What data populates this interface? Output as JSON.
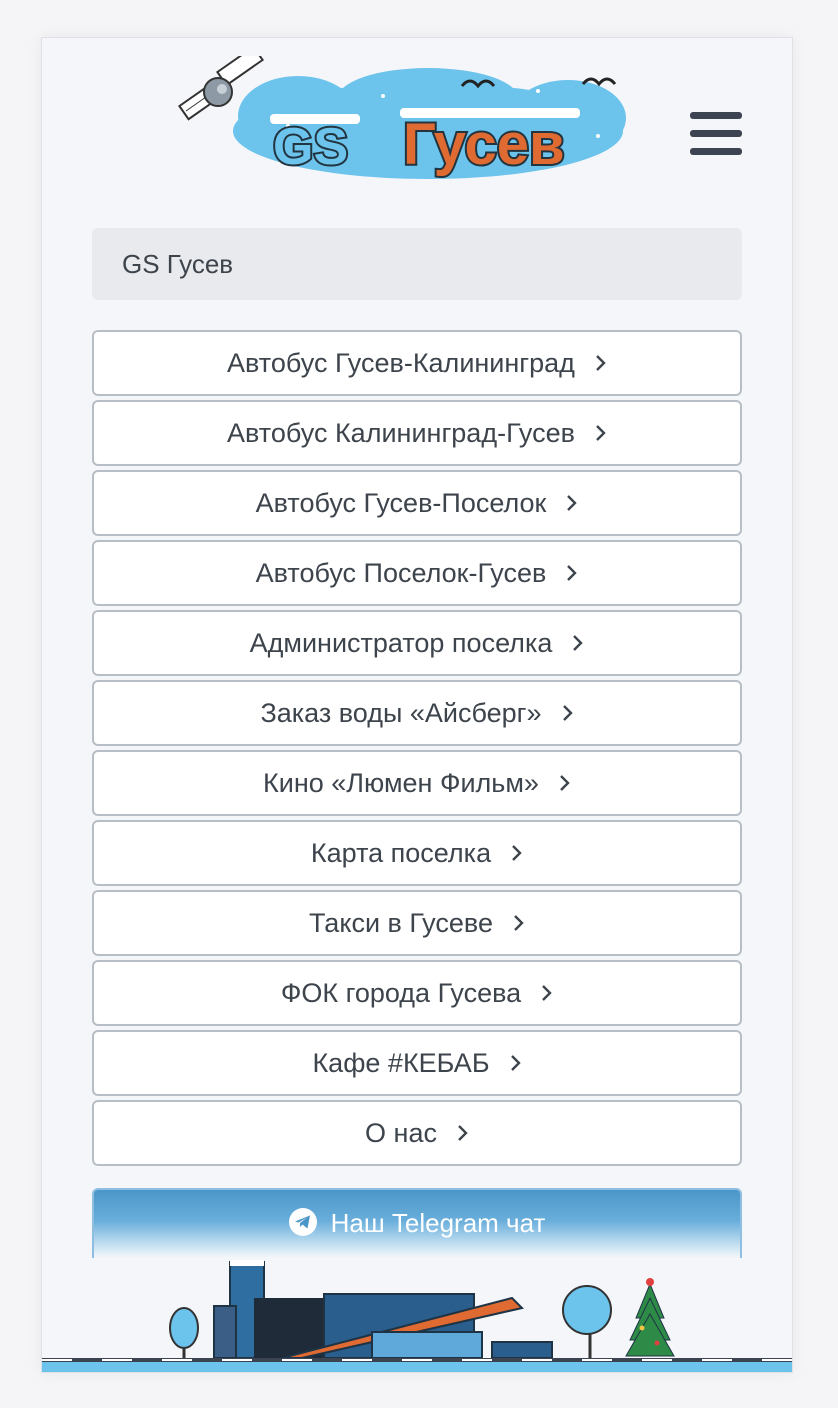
{
  "header": {
    "logo_text_left": "GS",
    "logo_text_right": "Гусев",
    "menu_icon": "hamburger-icon"
  },
  "breadcrumb": {
    "current": "GS Гусев"
  },
  "links": [
    {
      "label": "Автобус Гусев-Калининград"
    },
    {
      "label": "Автобус Калининград-Гусев"
    },
    {
      "label": "Автобус Гусев-Поселок"
    },
    {
      "label": "Автобус Поселок-Гусев"
    },
    {
      "label": "Администратор поселка"
    },
    {
      "label": "Заказ воды «Айсберг»"
    },
    {
      "label": "Кино «Люмен Фильм»"
    },
    {
      "label": "Карта поселка"
    },
    {
      "label": "Такси в Гусеве"
    },
    {
      "label": "ФОК города Гусева"
    },
    {
      "label": "Кафе #КЕБАБ"
    },
    {
      "label": "О нас"
    }
  ],
  "telegram": {
    "label": "Наш Telegram чат",
    "icon": "telegram-icon"
  },
  "colors": {
    "accent_blue": "#4a96c9",
    "text": "#3d444c",
    "logo_orange": "#e06b32",
    "logo_blue": "#6cc3ec"
  }
}
